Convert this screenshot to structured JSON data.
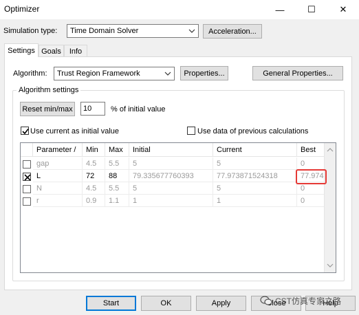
{
  "window": {
    "title": "Optimizer",
    "minimize": "—",
    "maximize": "☐",
    "close": "✕"
  },
  "simulation": {
    "label": "Simulation type:",
    "value": "Time Domain Solver",
    "acceleration_button": "Acceleration..."
  },
  "tabs": [
    {
      "label": "Settings",
      "active": true
    },
    {
      "label": "Goals",
      "active": false
    },
    {
      "label": "Info",
      "active": false
    }
  ],
  "algorithm": {
    "label": "Algorithm:",
    "value": "Trust Region Framework",
    "properties_button": "Properties...",
    "general_properties_button": "General Properties..."
  },
  "algorithm_settings": {
    "legend": "Algorithm settings",
    "reset_button": "Reset min/max",
    "percent_value": "10",
    "percent_label": "% of initial value",
    "use_current_label": "Use current as initial value",
    "use_current_checked": true,
    "use_previous_label": "Use data of previous calculations",
    "use_previous_checked": false
  },
  "table": {
    "headers": [
      "Parameter  /",
      "Min",
      "Max",
      "Initial",
      "Current",
      "Best"
    ],
    "rows": [
      {
        "checked": false,
        "values": [
          "gap",
          "4.5",
          "5.5",
          "5",
          "5",
          "0"
        ]
      },
      {
        "checked": true,
        "values": [
          "L",
          "72",
          "88",
          "79.335677760393",
          "77.973871524318",
          "77.974"
        ]
      },
      {
        "checked": false,
        "values": [
          "N",
          "4.5",
          "5.5",
          "5",
          "5",
          "0"
        ]
      },
      {
        "checked": false,
        "values": [
          "r",
          "0.9",
          "1.1",
          "1",
          "1",
          "0"
        ]
      }
    ]
  },
  "footer": {
    "start": "Start",
    "ok": "OK",
    "apply": "Apply",
    "close": "Close",
    "help": "Help"
  },
  "watermark": {
    "text": "CST仿真专家之路"
  },
  "colors": {
    "highlight": "#e53935",
    "accent": "#0078d7"
  }
}
